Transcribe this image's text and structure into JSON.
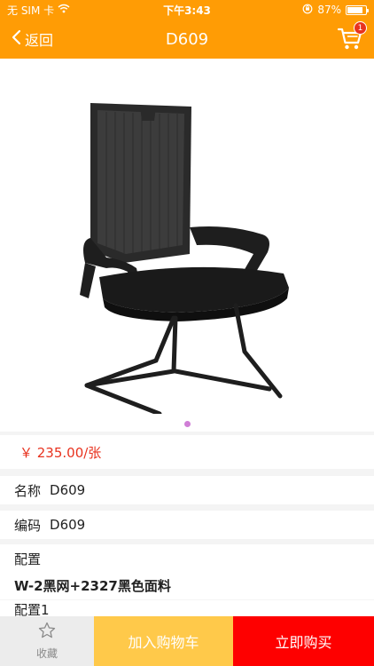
{
  "status_bar": {
    "carrier": "无 SIM 卡",
    "time": "下午3:43",
    "battery": "87%",
    "battery_level": 0.87,
    "icons": [
      "wifi-icon",
      "orientation-lock-icon",
      "battery-icon"
    ]
  },
  "nav": {
    "back_label": "返回",
    "title": "D609",
    "cart_count": "1",
    "icons": [
      "chevron-left-icon",
      "cart-icon"
    ]
  },
  "gallery": {
    "image": "office-chair-photo",
    "pages": 1,
    "current_page": 1
  },
  "product": {
    "price": "￥ 235.00/张",
    "name_label": "名称",
    "name_value": "D609",
    "code_label": "编码",
    "code_value": "D609",
    "config_label": "配置",
    "config_value": "W-2黑网+2327黑色面料",
    "config1_label": "配置1"
  },
  "actions": {
    "favorite_label": "收藏",
    "add_to_cart_label": "加入购物车",
    "buy_now_label": "立即购买",
    "icons": [
      "star-outline-icon"
    ]
  },
  "colors": {
    "header": "#ff9c05",
    "price": "#e8321e",
    "add_to_cart": "#ffc94a",
    "buy_now": "#fe0000",
    "favorite_bg": "#ececec",
    "badge": "#e8321e",
    "page_dot": "#d07ed6"
  }
}
